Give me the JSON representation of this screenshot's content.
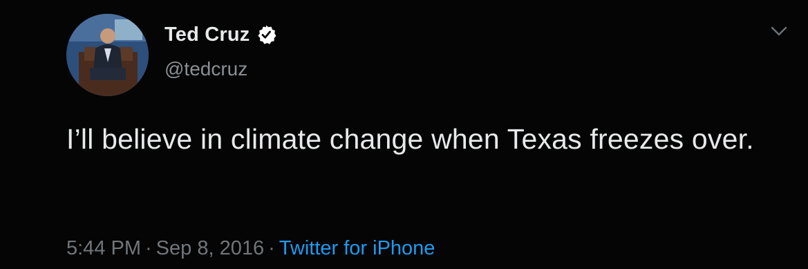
{
  "author": {
    "display_name": "Ted Cruz",
    "handle": "@tedcruz",
    "verified": true,
    "avatar_icon": "profile-photo"
  },
  "tweet": {
    "text": "I’ll believe in climate change when Texas freezes over.",
    "time": "5:44 PM",
    "date": "Sep 8, 2016",
    "source": "Twitter for iPhone",
    "separator": "·"
  },
  "icons": {
    "menu": "chevron-down-icon",
    "badge": "verified-badge-icon"
  },
  "colors": {
    "background": "#050505",
    "text": "#e7e9ea",
    "muted": "#71767b",
    "link": "#1d9bf0",
    "badge": "#ffffff"
  }
}
